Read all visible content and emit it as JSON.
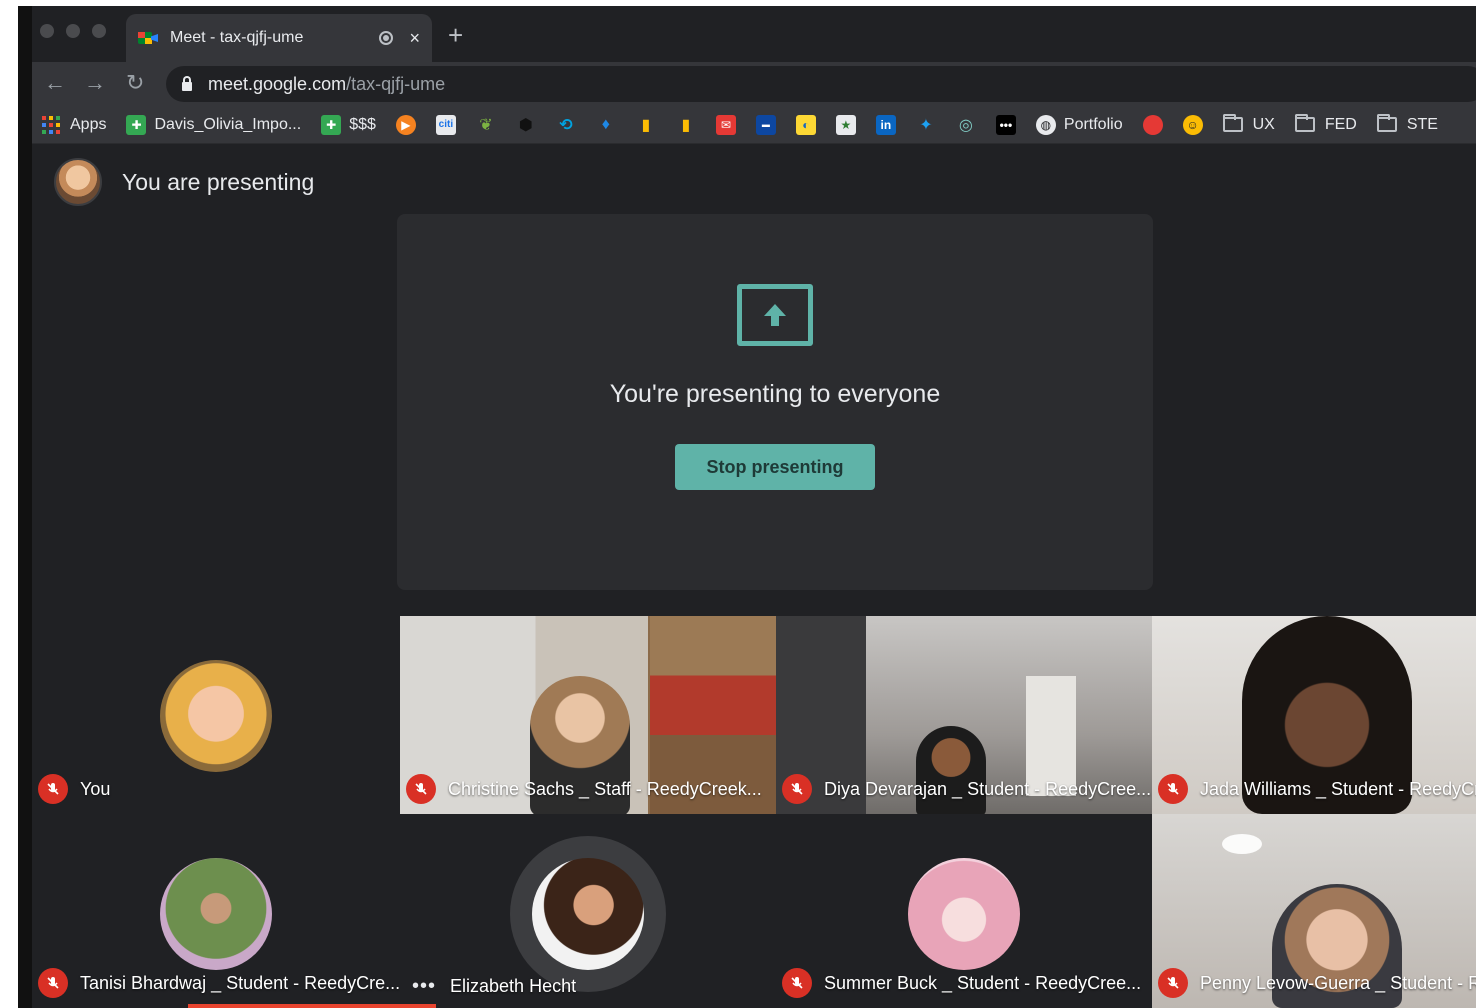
{
  "browser": {
    "tab": {
      "title": "Meet - tax-qjfj-ume",
      "close": "×"
    },
    "new_tab": "+",
    "nav": {
      "back": "←",
      "forward": "→",
      "reload": "↻"
    },
    "url": {
      "host": "meet.google.com",
      "path": "/tax-qjfj-ume"
    },
    "bookmarks": {
      "apps": "Apps",
      "davis": "Davis_Olivia_Impo...",
      "money": "$$$",
      "portfolio": "Portfolio",
      "ux": "UX",
      "fed": "FED",
      "ste": "STE"
    }
  },
  "meet": {
    "presenting_label": "You are presenting",
    "present_message": "You're presenting to everyone",
    "stop_button": "Stop presenting",
    "participants": [
      {
        "name": "You"
      },
      {
        "name": "Christine Sachs _ Staff - ReedyCreek..."
      },
      {
        "name": "Diya Devarajan _ Student - ReedyCree..."
      },
      {
        "name": "Jada Williams _ Student - ReedyCr"
      },
      {
        "name": "Tanisi Bhardwaj _ Student - ReedyCre..."
      },
      {
        "name": "Elizabeth Hecht"
      },
      {
        "name": "Summer Buck _ Student - ReedyCree..."
      },
      {
        "name": "Penny Levow-Guerra _ Student - Re"
      }
    ]
  },
  "colors": {
    "accent": "#5fb3a8",
    "background": "#202124",
    "mute_red": "#d93025"
  }
}
